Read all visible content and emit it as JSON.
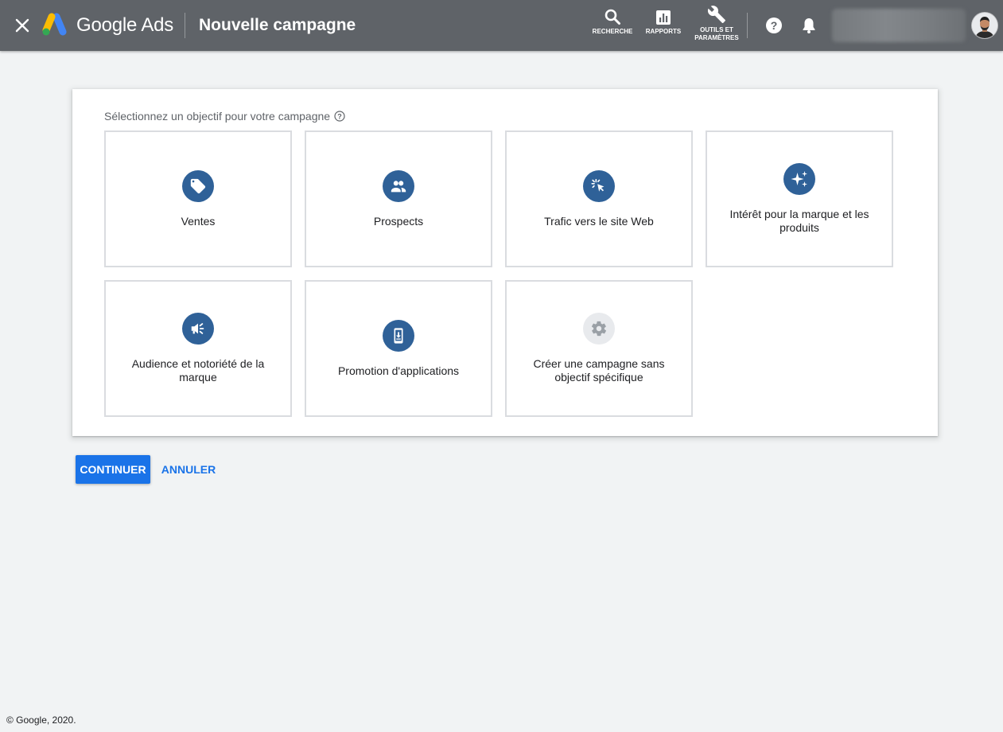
{
  "header": {
    "brand": "Google Ads",
    "page_title": "Nouvelle campagne",
    "background_color": "#5f6368",
    "tools": [
      {
        "label": "RECHERCHE",
        "icon": "search-icon"
      },
      {
        "label": "RAPPORTS",
        "icon": "bar-chart-icon"
      },
      {
        "label": "OUTILS ET\nPARAMÈTRES",
        "icon": "wrench-icon"
      }
    ],
    "icons": {
      "close": "close-icon",
      "help": "help-icon",
      "notifications": "bell-icon",
      "avatar": "avatar"
    }
  },
  "objectives": {
    "prompt": "Sélectionnez un objectif pour votre campagne",
    "icon_color": "#2f6198",
    "tiles": [
      {
        "label": "Ventes",
        "icon": "tag-icon"
      },
      {
        "label": "Prospects",
        "icon": "people-icon"
      },
      {
        "label": "Trafic vers le site Web",
        "icon": "cursor-click-icon"
      },
      {
        "label": "Intérêt pour la marque et les produits",
        "icon": "sparkle-icon"
      },
      {
        "label": "Audience et notoriété de la marque",
        "icon": "megaphone-icon"
      },
      {
        "label": "Promotion d'applications",
        "icon": "phone-download-icon"
      },
      {
        "label": "Créer une campagne sans objectif spécifique",
        "icon": "gear-icon"
      }
    ]
  },
  "actions": {
    "continue_label": "CONTINUER",
    "cancel_label": "ANNULER",
    "primary_color": "#1a73e8"
  },
  "footer": {
    "copyright": "© Google, 2020."
  }
}
